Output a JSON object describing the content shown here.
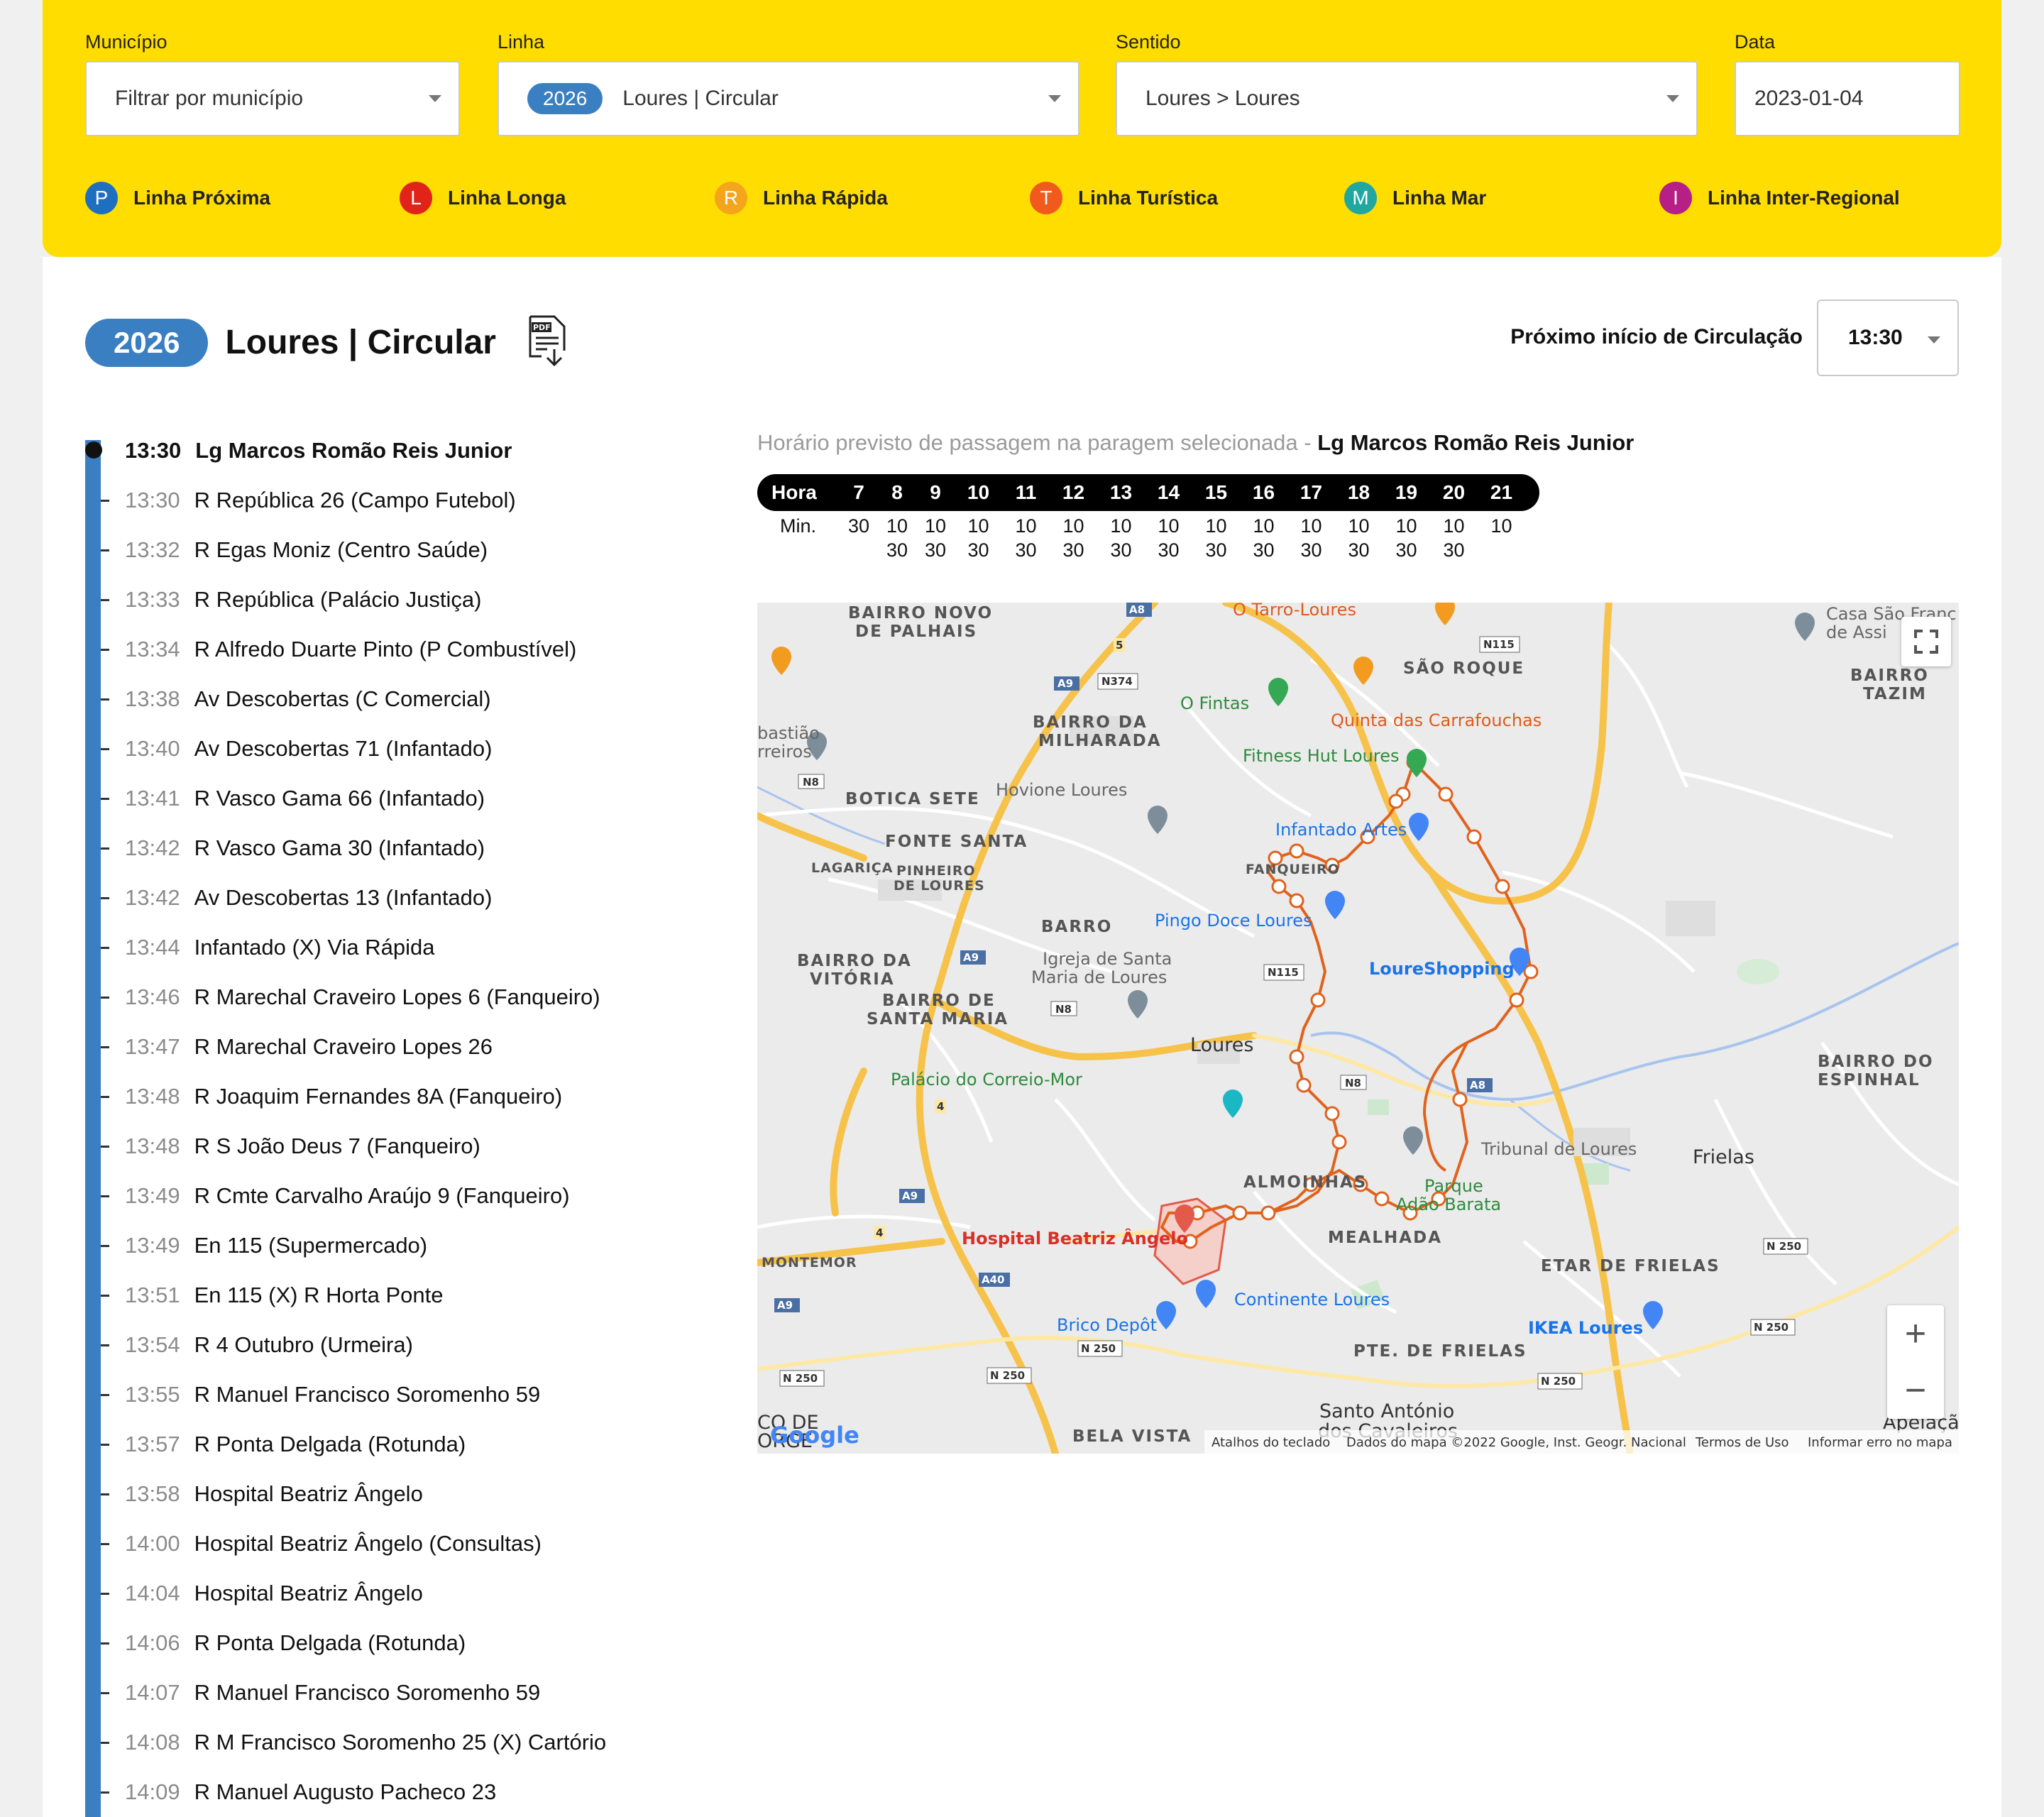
{
  "filters": {
    "municipio": {
      "label": "Município",
      "placeholder": "Filtrar por município"
    },
    "linha": {
      "label": "Linha",
      "number": "2026",
      "name": "Loures | Circular"
    },
    "sentido": {
      "label": "Sentido",
      "value": "Loures > Loures"
    },
    "data": {
      "label": "Data",
      "value": "2023-01-04"
    }
  },
  "legend": [
    {
      "letter": "P",
      "label": "Linha Próxima",
      "color": "#1f6fc1"
    },
    {
      "letter": "L",
      "label": "Linha Longa",
      "color": "#e2231a"
    },
    {
      "letter": "R",
      "label": "Linha Rápida",
      "color": "#f4a51c"
    },
    {
      "letter": "T",
      "label": "Linha Turística",
      "color": "#f05a1c"
    },
    {
      "letter": "M",
      "label": "Linha Mar",
      "color": "#20a8a0"
    },
    {
      "letter": "I",
      "label": "Linha Inter-Regional",
      "color": "#b51f86"
    }
  ],
  "route": {
    "number": "2026",
    "name": "Loures | Circular",
    "pdf_icon": "pdf-download-icon",
    "next_start_label": "Próximo início de Circulação",
    "next_start_value": "13:30"
  },
  "stops": [
    {
      "time": "13:30",
      "name": "Lg Marcos Romão Reis Junior"
    },
    {
      "time": "13:30",
      "name": "R República 26 (Campo Futebol)"
    },
    {
      "time": "13:32",
      "name": "R Egas Moniz (Centro Saúde)"
    },
    {
      "time": "13:33",
      "name": "R República (Palácio Justiça)"
    },
    {
      "time": "13:34",
      "name": "R Alfredo Duarte Pinto (P Combustível)"
    },
    {
      "time": "13:38",
      "name": "Av Descobertas (C Comercial)"
    },
    {
      "time": "13:40",
      "name": "Av Descobertas 71 (Infantado)"
    },
    {
      "time": "13:41",
      "name": "R Vasco Gama 66 (Infantado)"
    },
    {
      "time": "13:42",
      "name": "R Vasco Gama 30 (Infantado)"
    },
    {
      "time": "13:42",
      "name": "Av Descobertas 13 (Infantado)"
    },
    {
      "time": "13:44",
      "name": "Infantado (X) Via Rápida"
    },
    {
      "time": "13:46",
      "name": "R Marechal Craveiro Lopes 6 (Fanqueiro)"
    },
    {
      "time": "13:47",
      "name": "R Marechal Craveiro Lopes 26"
    },
    {
      "time": "13:48",
      "name": "R Joaquim Fernandes 8A (Fanqueiro)"
    },
    {
      "time": "13:48",
      "name": "R S João Deus 7 (Fanqueiro)"
    },
    {
      "time": "13:49",
      "name": "R Cmte Carvalho Araújo 9 (Fanqueiro)"
    },
    {
      "time": "13:49",
      "name": "En 115 (Supermercado)"
    },
    {
      "time": "13:51",
      "name": "En 115 (X) R Horta Ponte"
    },
    {
      "time": "13:54",
      "name": "R 4 Outubro (Urmeira)"
    },
    {
      "time": "13:55",
      "name": "R Manuel Francisco Soromenho 59"
    },
    {
      "time": "13:57",
      "name": "R Ponta Delgada (Rotunda)"
    },
    {
      "time": "13:58",
      "name": "Hospital Beatriz Ângelo"
    },
    {
      "time": "14:00",
      "name": "Hospital Beatriz Ângelo (Consultas)"
    },
    {
      "time": "14:04",
      "name": "Hospital Beatriz Ângelo"
    },
    {
      "time": "14:06",
      "name": "R Ponta Delgada (Rotunda)"
    },
    {
      "time": "14:07",
      "name": "R Manuel Francisco Soromenho 59"
    },
    {
      "time": "14:08",
      "name": "R M Francisco Soromenho 25 (X) Cartório"
    },
    {
      "time": "14:09",
      "name": "R Manuel Augusto Pacheco 23"
    }
  ],
  "schedule": {
    "caption": "Horário previsto de passagem na paragem selecionada - ",
    "stop_name": "Lg Marcos Romão Reis Junior",
    "hour_label": "Hora",
    "min_label": "Min.",
    "hours": [
      "7",
      "8",
      "9",
      "10",
      "11",
      "12",
      "13",
      "14",
      "15",
      "16",
      "17",
      "18",
      "19",
      "20",
      "21"
    ],
    "minutes": [
      [
        "30"
      ],
      [
        "10",
        "30"
      ],
      [
        "10",
        "30"
      ],
      [
        "10",
        "30"
      ],
      [
        "10",
        "30"
      ],
      [
        "10",
        "30"
      ],
      [
        "10",
        "30"
      ],
      [
        "10",
        "30"
      ],
      [
        "10",
        "30"
      ],
      [
        "10",
        "30"
      ],
      [
        "10",
        "30"
      ],
      [
        "10",
        "30"
      ],
      [
        "10",
        "30"
      ],
      [
        "10",
        "30"
      ],
      [
        "10"
      ]
    ]
  },
  "map": {
    "labels": [
      "BAIRRO NOVO",
      "DE PALHAIS",
      "O Tarro-Loures",
      "Casa São Franc",
      "de Assi",
      "BAIRRO",
      "TAZIM",
      "SÃO ROQUE",
      "O Fintas",
      "Quinta das Carrafouchas",
      "BAIRRO DA",
      "MILHARADA",
      "Fitness Hut Loures",
      "bastião",
      "rreiros",
      "BOTICA SETE",
      "Hovione Loures",
      "Infantado Artes",
      "FONTE SANTA",
      "LAGARIÇA",
      "PINHEIRO",
      "DE LOURES",
      "FANQUEIRO",
      "Pingo Doce Loures",
      "BARRO",
      "LoureShopping",
      "BAIRRO DA",
      "VITÓRIA",
      "Igreja de Santa",
      "Maria de Loures",
      "BAIRRO DE",
      "SANTA MARIA",
      "Loures",
      "BAIRRO DO",
      "ESPINHAL",
      "Palácio do Correio-Mor",
      "Tribunal de Loures",
      "Parque",
      "Adão Barata",
      "Frielas",
      "ALMOINHAS",
      "Hospital Beatriz Ângelo",
      "MEALHADA",
      "ETAR DE FRIELAS",
      "MONTEMOR",
      "Continente Loures",
      "Brico Depôt",
      "IKEA Loures",
      "PTE. DE FRIELAS",
      "Santo António",
      "dos Cavaleiros",
      "BELA VISTA",
      "Apelação",
      "CO DE",
      "ORGE"
    ],
    "road_labels": [
      "A8",
      "A9",
      "N374",
      "N115",
      "N8",
      "A9",
      "N115",
      "N8",
      "A8",
      "N8",
      "4",
      "A9",
      "4",
      "A40",
      "A9",
      "N 250",
      "N 250",
      "N 250",
      "N 250",
      "N 250",
      "N 250",
      "5"
    ],
    "footer": {
      "logo": "Google",
      "shortcuts": "Atalhos do teclado",
      "data": "Dados do mapa ©2022 Google, Inst. Geogr. Nacional",
      "terms": "Termos de Uso",
      "report": "Informar erro no mapa"
    },
    "controls": {
      "fullscreen": "fullscreen-icon",
      "zoom_in": "+",
      "zoom_out": "−"
    }
  }
}
